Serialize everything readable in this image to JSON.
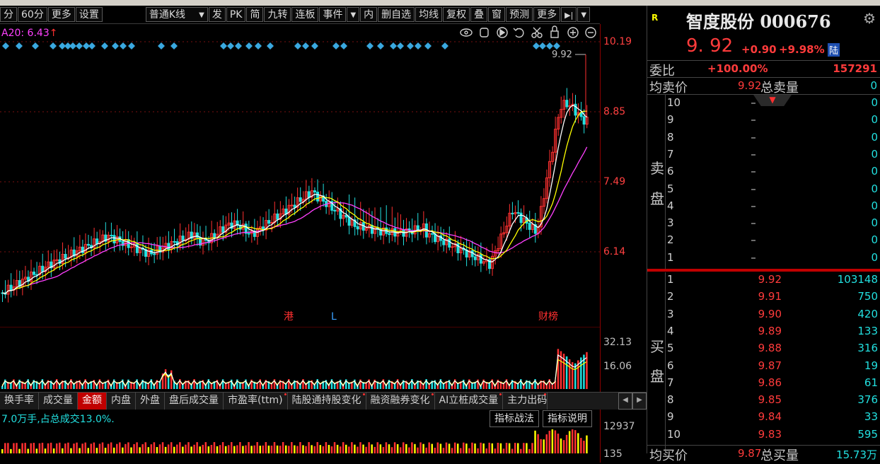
{
  "toolbar": {
    "items": [
      "分",
      "60分",
      "更多",
      "设置"
    ],
    "kline_select": "普通K线",
    "buttons": [
      "发",
      "PK",
      "简",
      "九转",
      "连板",
      "事件"
    ],
    "buttons2": [
      "内",
      "删自选",
      "均线",
      "复权",
      "叠",
      "窗",
      "预测",
      "更多"
    ],
    "arrow": "▼",
    "pin": "▶|"
  },
  "main_chart": {
    "ma_label": "A20: 6.43",
    "ma_arrow": "↑",
    "last_price_tag": "9.92",
    "price_axis": [
      "10.19",
      "8.85",
      "7.49",
      "6.14"
    ],
    "markers": [
      {
        "text": "港",
        "color": "#ff3030"
      },
      {
        "text": "L",
        "color": "#3aa0ff"
      },
      {
        "text": "财榜",
        "color": "#ff3030"
      }
    ],
    "tool_icons": [
      "eye-icon",
      "hand-icon",
      "play-icon",
      "undo-icon",
      "scissors-icon",
      "lock-icon",
      "zoom-in-icon",
      "zoom-out-icon"
    ]
  },
  "volume_chart": {
    "axis": [
      "32.13",
      "16.06"
    ]
  },
  "tabs": [
    {
      "label": "换手率",
      "dot": false
    },
    {
      "label": "成交量",
      "dot": false
    },
    {
      "label": "金额",
      "dot": false,
      "active": true
    },
    {
      "label": "内盘",
      "dot": false
    },
    {
      "label": "外盘",
      "dot": false
    },
    {
      "label": "盘后成交量",
      "dot": false
    },
    {
      "label": "市盈率(ttm)",
      "dot": true
    },
    {
      "label": "陆股通持股变化",
      "dot": true
    },
    {
      "label": "融资融券变化",
      "dot": true
    },
    {
      "label": "AI立桩成交量",
      "dot": true
    },
    {
      "label": "主力出码",
      "dot": true
    }
  ],
  "indicator_bar": {
    "text": "7.0万手,占总成交13.0%.",
    "btn1": "指标战法",
    "btn2": "指标说明",
    "axis_top": "12937",
    "axis_bottom": "135"
  },
  "quote": {
    "logo": "R",
    "name": "智度股份",
    "code": "000676",
    "price": "9. 92",
    "change": "+0.90",
    "pct": "+9.98%",
    "badge": "陆",
    "gear": "gear-icon",
    "weibi_label": "委比",
    "weibi_value": "+100.00%",
    "weibi_diff": "157291",
    "avg_sell_label": "均卖价",
    "avg_sell_value": "9.92",
    "total_sell_label": "总卖量",
    "total_sell_value": "0",
    "sell_side_label": [
      "卖",
      "盘"
    ],
    "buy_side_label": [
      "买",
      "盘"
    ],
    "sells": [
      {
        "lv": "10",
        "px": "–",
        "vol": "0"
      },
      {
        "lv": "9",
        "px": "–",
        "vol": "0"
      },
      {
        "lv": "8",
        "px": "–",
        "vol": "0"
      },
      {
        "lv": "7",
        "px": "–",
        "vol": "0"
      },
      {
        "lv": "6",
        "px": "–",
        "vol": "0"
      },
      {
        "lv": "5",
        "px": "–",
        "vol": "0"
      },
      {
        "lv": "4",
        "px": "–",
        "vol": "0"
      },
      {
        "lv": "3",
        "px": "–",
        "vol": "0"
      },
      {
        "lv": "2",
        "px": "–",
        "vol": "0"
      },
      {
        "lv": "1",
        "px": "–",
        "vol": "0"
      }
    ],
    "buys": [
      {
        "lv": "1",
        "px": "9.92",
        "vol": "103148"
      },
      {
        "lv": "2",
        "px": "9.91",
        "vol": "750"
      },
      {
        "lv": "3",
        "px": "9.90",
        "vol": "420"
      },
      {
        "lv": "4",
        "px": "9.89",
        "vol": "133"
      },
      {
        "lv": "5",
        "px": "9.88",
        "vol": "316"
      },
      {
        "lv": "6",
        "px": "9.87",
        "vol": "19"
      },
      {
        "lv": "7",
        "px": "9.86",
        "vol": "61"
      },
      {
        "lv": "8",
        "px": "9.85",
        "vol": "376"
      },
      {
        "lv": "9",
        "px": "9.84",
        "vol": "33"
      },
      {
        "lv": "10",
        "px": "9.83",
        "vol": "595"
      }
    ],
    "avg_buy_label": "均买价",
    "avg_buy_value": "9.87",
    "total_buy_label": "总买量",
    "total_buy_value": "15.73万"
  },
  "colors": {
    "up": "#ff3b3b",
    "down": "#22e0e0",
    "ma5": "#ffffff",
    "ma10": "#ffff00",
    "ma20": "#ff40ff",
    "bg": "#000000"
  }
}
